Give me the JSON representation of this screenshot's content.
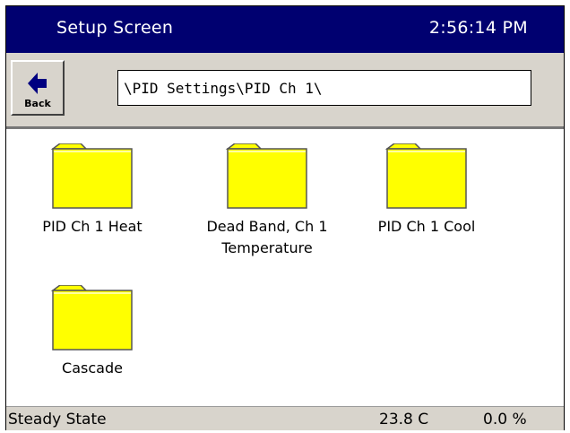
{
  "header": {
    "title": "Setup Screen",
    "clock": "2:56:14 PM"
  },
  "toolbar": {
    "back_label": "Back",
    "path": "\\PID Settings\\PID Ch 1\\"
  },
  "folders": [
    {
      "label": "PID Ch 1 Heat"
    },
    {
      "label": "Dead Band, Ch 1\nTemperature"
    },
    {
      "label": "PID Ch 1 Cool"
    },
    {
      "label": "Cascade"
    }
  ],
  "status": {
    "state": "Steady State",
    "temperature": "23.8 C",
    "output": "0.0 %"
  },
  "colors": {
    "titlebar": "#000070",
    "folder": "#ffff00",
    "panel": "#d8d4cc",
    "back_arrow": "#000080"
  }
}
